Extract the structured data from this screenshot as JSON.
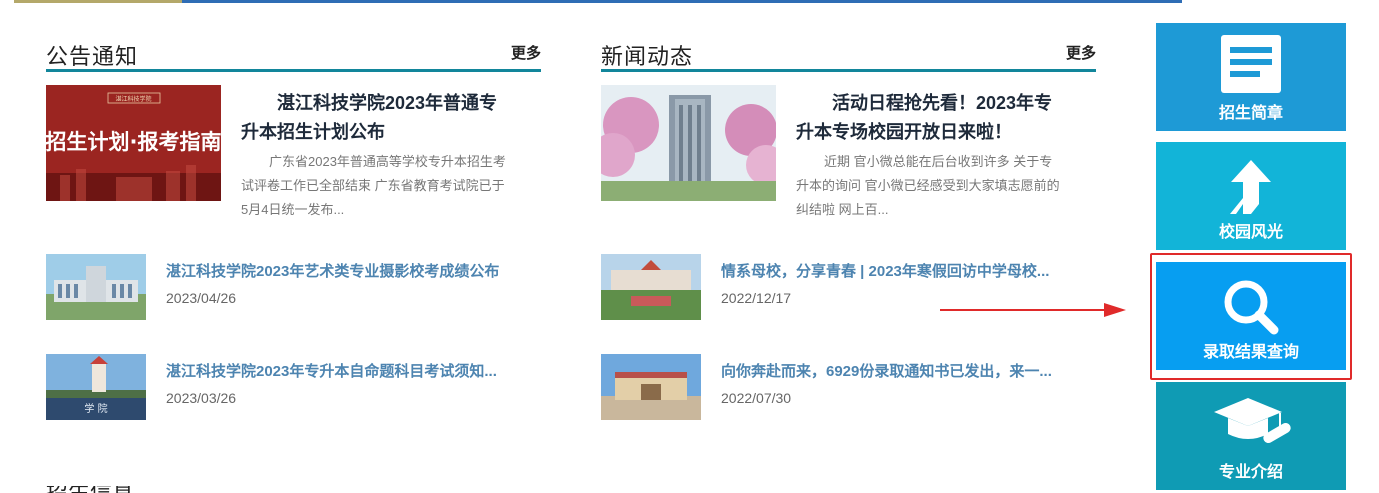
{
  "notice": {
    "title": "公告通知",
    "more": "更多",
    "featured": {
      "image_text": "招生计划·报考指南",
      "title": "湛江科技学院2023年普通专升本招生计划公布",
      "desc": "广东省2023年普通高等学校专升本招生考试评卷工作已全部结束 广东省教育考试院已于 5月4日统一发布..."
    },
    "items": [
      {
        "title": "湛江科技学院2023年艺术类专业摄影校考成绩公布",
        "date": "2023/04/26"
      },
      {
        "title": "湛江科技学院2023年专升本自命题科目考试须知...",
        "date": "2023/03/26"
      }
    ]
  },
  "news": {
    "title": "新闻动态",
    "more": "更多",
    "featured": {
      "title": "活动日程抢先看！2023年专升本专场校园开放日来啦！",
      "desc": "近期 官小微总能在后台收到许多 关于专升本的询问 官小微已经感受到大家填志愿前的纠结啦 网上百..."
    },
    "items": [
      {
        "title": "情系母校，分享青春 | 2023年寒假回访中学母校...",
        "date": "2022/12/17"
      },
      {
        "title": "向你奔赴而来，6929份录取通知书已发出，来一...",
        "date": "2022/07/30"
      }
    ]
  },
  "sidebar": {
    "tiles": [
      {
        "label": "招生简章",
        "icon": "document-icon",
        "color": "#1e9ad6"
      },
      {
        "label": "校园风光",
        "icon": "arrow-up-icon",
        "color": "#12b4d8"
      },
      {
        "label": "录取结果查询",
        "icon": "search-icon",
        "color": "#079ef1"
      },
      {
        "label": "专业介绍",
        "icon": "graduation-cap-icon",
        "color": "#0f9bb4"
      }
    ]
  },
  "annotation": {
    "highlight_color": "#e02a2a"
  },
  "colors": {
    "accent": "#12869b",
    "link": "#4d84b0"
  },
  "next_section_title": "招生信息"
}
